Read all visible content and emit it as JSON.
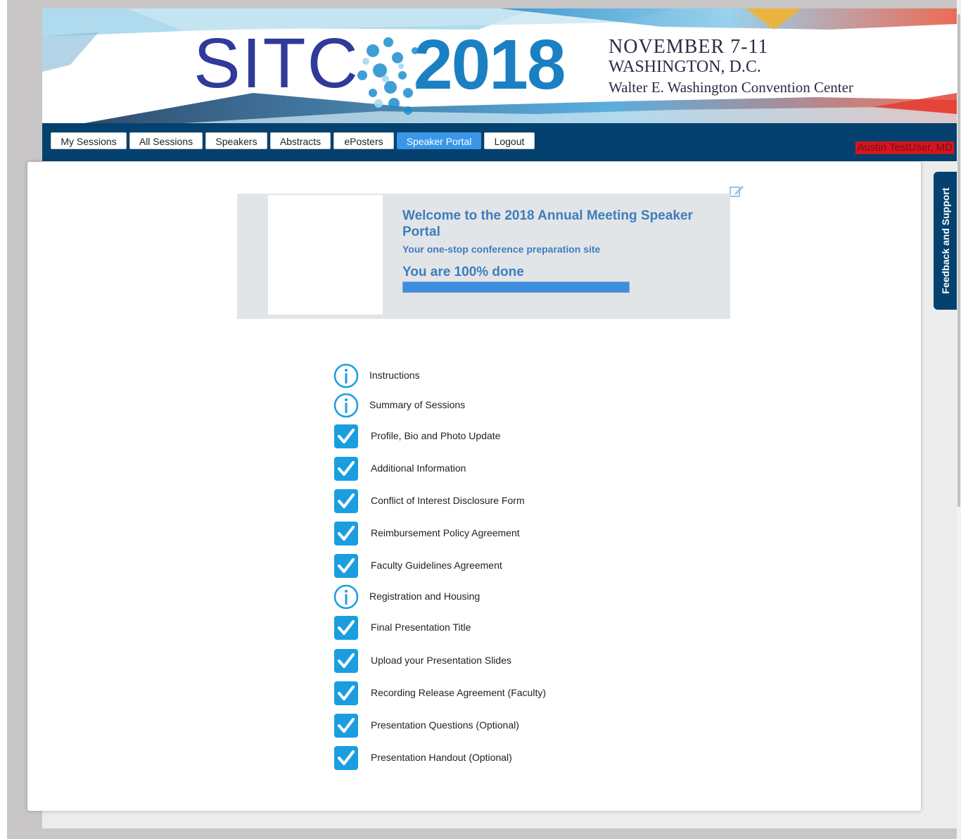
{
  "banner": {
    "logo_text": "SITC",
    "logo_year": "2018",
    "dates": "NOVEMBER 7-11",
    "city": "WASHINGTON, D.C.",
    "venue": "Walter E. Washington Convention Center"
  },
  "nav": {
    "items": [
      {
        "label": "My Sessions",
        "active": false
      },
      {
        "label": "All Sessions",
        "active": false
      },
      {
        "label": "Speakers",
        "active": false
      },
      {
        "label": "Abstracts",
        "active": false
      },
      {
        "label": "ePosters",
        "active": false
      },
      {
        "label": "Speaker Portal",
        "active": true
      },
      {
        "label": "Logout",
        "active": false
      }
    ],
    "user_name": "Austin TestUser, MD"
  },
  "welcome": {
    "title": "Welcome to the 2018 Annual Meeting Speaker Portal",
    "subtitle": "Your one-stop conference preparation site",
    "progress_text": "You are 100% done",
    "progress_value": 100
  },
  "checklist": [
    {
      "label": "Instructions",
      "icon": "info-icon"
    },
    {
      "label": "Summary of Sessions",
      "icon": "info-icon"
    },
    {
      "label": "Profile, Bio and Photo Update",
      "icon": "checkmark-icon"
    },
    {
      "label": "Additional Information",
      "icon": "checkmark-icon"
    },
    {
      "label": "Conflict of Interest Disclosure Form",
      "icon": "checkmark-icon"
    },
    {
      "label": "Reimbursement Policy Agreement",
      "icon": "checkmark-icon"
    },
    {
      "label": "Faculty Guidelines Agreement",
      "icon": "checkmark-icon"
    },
    {
      "label": "Registration and Housing",
      "icon": "info-icon"
    },
    {
      "label": "Final Presentation Title",
      "icon": "checkmark-icon"
    },
    {
      "label": "Upload your Presentation Slides",
      "icon": "checkmark-icon"
    },
    {
      "label": "Recording Release Agreement (Faculty)",
      "icon": "checkmark-icon"
    },
    {
      "label": "Presentation Questions (Optional)",
      "icon": "checkmark-icon"
    },
    {
      "label": "Presentation Handout (Optional)",
      "icon": "checkmark-icon"
    }
  ],
  "feedback_tab": "Feedback and Support",
  "colors": {
    "nav_bg": "#05416f",
    "accent_blue": "#3a97e8",
    "welcome_text": "#3e7dbc",
    "check_bg": "#1a9ee0"
  }
}
